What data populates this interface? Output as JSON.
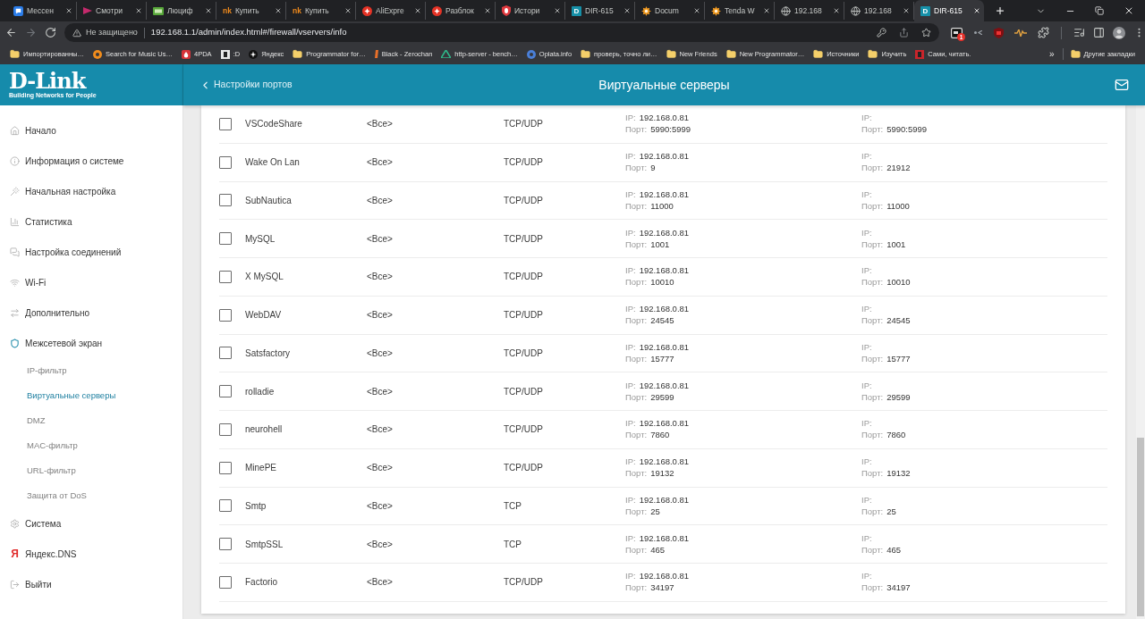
{
  "browser": {
    "tabs": [
      {
        "title": "Мессен",
        "selected": false
      },
      {
        "title": "Смотри",
        "selected": false
      },
      {
        "title": "Люциф",
        "selected": false
      },
      {
        "title": "Купить",
        "selected": false,
        "icon_text": "nk",
        "icon_boxed": false
      },
      {
        "title": "Купить",
        "selected": false,
        "icon_text": "nk",
        "icon_boxed": false
      },
      {
        "title": "AliExpre",
        "selected": false
      },
      {
        "title": "Разблок",
        "selected": false
      },
      {
        "title": "Истори",
        "selected": false
      },
      {
        "title": "DIR-615",
        "selected": false,
        "icon_text": "D",
        "icon_boxed": true
      },
      {
        "title": "Docum",
        "selected": false
      },
      {
        "title": "Tenda W",
        "selected": false
      },
      {
        "title": "192.168",
        "selected": false
      },
      {
        "title": "192.168",
        "selected": false
      },
      {
        "title": "DIR-615",
        "selected": true,
        "icon_text": "D",
        "icon_boxed": true
      }
    ],
    "address_bar": {
      "security": "Не защищено",
      "url": "192.168.1.1/admin/index.html#/firewall/vservers/info"
    },
    "extension_badge": "1",
    "bookmarks": [
      {
        "label": "Импортированны…",
        "kind": "folder"
      },
      {
        "label": "Search for Music Us…",
        "kind": "link"
      },
      {
        "label": "4PDA",
        "kind": "link"
      },
      {
        "label": ":D",
        "kind": "link"
      },
      {
        "label": "Яндекс",
        "kind": "link"
      },
      {
        "label": "Programmator for…",
        "kind": "folder"
      },
      {
        "label": "Black - Zerochan",
        "kind": "link"
      },
      {
        "label": "http-server - bench…",
        "kind": "link"
      },
      {
        "label": "Oplata.info",
        "kind": "link"
      },
      {
        "label": "проверь, точно ли…",
        "kind": "folder"
      },
      {
        "label": "New Friends",
        "kind": "folder"
      },
      {
        "label": "New Programmator…",
        "kind": "folder"
      },
      {
        "label": "Источники",
        "kind": "folder"
      },
      {
        "label": "Изучить",
        "kind": "folder"
      },
      {
        "label": "Сами, читать.",
        "kind": "link"
      }
    ],
    "bookmarks_overflow": "»",
    "other_bookmarks": "Другие закладки"
  },
  "router": {
    "logo": {
      "name": "D-Link",
      "tagline": "Building Networks for People"
    },
    "back_link": "Настройки портов",
    "page_title": "Виртуальные серверы",
    "sidebar": {
      "items": [
        {
          "label": "Начало",
          "selected": false
        },
        {
          "label": "Информация о системе",
          "selected": false
        },
        {
          "label": "Начальная настройка",
          "selected": false
        },
        {
          "label": "Статистика",
          "selected": false
        },
        {
          "label": "Настройка соединений",
          "selected": false
        },
        {
          "label": "Wi-Fi",
          "selected": false
        },
        {
          "label": "Дополнительно",
          "selected": false
        },
        {
          "label": "Межсетевой экран",
          "selected": false,
          "expanded": true,
          "children": [
            {
              "label": "IP-фильтр",
              "selected": false
            },
            {
              "label": "Виртуальные серверы",
              "selected": true
            },
            {
              "label": "DMZ",
              "selected": false
            },
            {
              "label": "MAC-фильтр",
              "selected": false
            },
            {
              "label": "URL-фильтр",
              "selected": false
            },
            {
              "label": "Защита от DoS",
              "selected": false
            }
          ]
        },
        {
          "label": "Система",
          "selected": false
        },
        {
          "label": "Яндекс.DNS",
          "selected": false,
          "glyph": "Я"
        },
        {
          "label": "Выйти",
          "selected": false
        }
      ]
    },
    "table": {
      "rows": [
        {
          "checked": false,
          "name": "VSCodeShare",
          "interface": "<Все>",
          "protocol": "TCP/UDP",
          "internal": {
            "ip_label": "IP:",
            "ip": "192.168.0.81",
            "port_label": "Порт:",
            "port": "5990:5999"
          },
          "external": {
            "ip_label": "IP:",
            "port_label": "Порт:",
            "port": "5990:5999"
          }
        },
        {
          "checked": false,
          "name": "Wake On Lan",
          "interface": "<Все>",
          "protocol": "TCP/UDP",
          "internal": {
            "ip_label": "IP:",
            "ip": "192.168.0.81",
            "port_label": "Порт:",
            "port": "9"
          },
          "external": {
            "ip_label": "IP:",
            "port_label": "Порт:",
            "port": "21912"
          }
        },
        {
          "checked": false,
          "name": "SubNautica",
          "interface": "<Все>",
          "protocol": "TCP/UDP",
          "internal": {
            "ip_label": "IP:",
            "ip": "192.168.0.81",
            "port_label": "Порт:",
            "port": "11000"
          },
          "external": {
            "ip_label": "IP:",
            "port_label": "Порт:",
            "port": "11000"
          }
        },
        {
          "checked": false,
          "name": "MySQL",
          "interface": "<Все>",
          "protocol": "TCP/UDP",
          "internal": {
            "ip_label": "IP:",
            "ip": "192.168.0.81",
            "port_label": "Порт:",
            "port": "1001"
          },
          "external": {
            "ip_label": "IP:",
            "port_label": "Порт:",
            "port": "1001"
          }
        },
        {
          "checked": false,
          "name": "X MySQL",
          "interface": "<Все>",
          "protocol": "TCP/UDP",
          "internal": {
            "ip_label": "IP:",
            "ip": "192.168.0.81",
            "port_label": "Порт:",
            "port": "10010"
          },
          "external": {
            "ip_label": "IP:",
            "port_label": "Порт:",
            "port": "10010"
          }
        },
        {
          "checked": false,
          "name": "WebDAV",
          "interface": "<Все>",
          "protocol": "TCP/UDP",
          "internal": {
            "ip_label": "IP:",
            "ip": "192.168.0.81",
            "port_label": "Порт:",
            "port": "24545"
          },
          "external": {
            "ip_label": "IP:",
            "port_label": "Порт:",
            "port": "24545"
          }
        },
        {
          "checked": false,
          "name": "Satsfactory",
          "interface": "<Все>",
          "protocol": "TCP/UDP",
          "internal": {
            "ip_label": "IP:",
            "ip": "192.168.0.81",
            "port_label": "Порт:",
            "port": "15777"
          },
          "external": {
            "ip_label": "IP:",
            "port_label": "Порт:",
            "port": "15777"
          }
        },
        {
          "checked": false,
          "name": "rolladie",
          "interface": "<Все>",
          "protocol": "TCP/UDP",
          "internal": {
            "ip_label": "IP:",
            "ip": "192.168.0.81",
            "port_label": "Порт:",
            "port": "29599"
          },
          "external": {
            "ip_label": "IP:",
            "port_label": "Порт:",
            "port": "29599"
          }
        },
        {
          "checked": false,
          "name": "neurohell",
          "interface": "<Все>",
          "protocol": "TCP/UDP",
          "internal": {
            "ip_label": "IP:",
            "ip": "192.168.0.81",
            "port_label": "Порт:",
            "port": "7860"
          },
          "external": {
            "ip_label": "IP:",
            "port_label": "Порт:",
            "port": "7860"
          }
        },
        {
          "checked": false,
          "name": "MinePE",
          "interface": "<Все>",
          "protocol": "TCP/UDP",
          "internal": {
            "ip_label": "IP:",
            "ip": "192.168.0.81",
            "port_label": "Порт:",
            "port": "19132"
          },
          "external": {
            "ip_label": "IP:",
            "port_label": "Порт:",
            "port": "19132"
          }
        },
        {
          "checked": false,
          "name": "Smtp",
          "interface": "<Все>",
          "protocol": "TCP",
          "internal": {
            "ip_label": "IP:",
            "ip": "192.168.0.81",
            "port_label": "Порт:",
            "port": "25"
          },
          "external": {
            "ip_label": "IP:",
            "port_label": "Порт:",
            "port": "25"
          }
        },
        {
          "checked": false,
          "name": "SmtpSSL",
          "interface": "<Все>",
          "protocol": "TCP",
          "internal": {
            "ip_label": "IP:",
            "ip": "192.168.0.81",
            "port_label": "Порт:",
            "port": "465"
          },
          "external": {
            "ip_label": "IP:",
            "port_label": "Порт:",
            "port": "465"
          }
        },
        {
          "checked": false,
          "name": "Factorio",
          "interface": "<Все>",
          "protocol": "TCP/UDP",
          "internal": {
            "ip_label": "IP:",
            "ip": "192.168.0.81",
            "port_label": "Порт:",
            "port": "34197"
          },
          "external": {
            "ip_label": "IP:",
            "port_label": "Порт:",
            "port": "34197"
          }
        }
      ]
    }
  }
}
